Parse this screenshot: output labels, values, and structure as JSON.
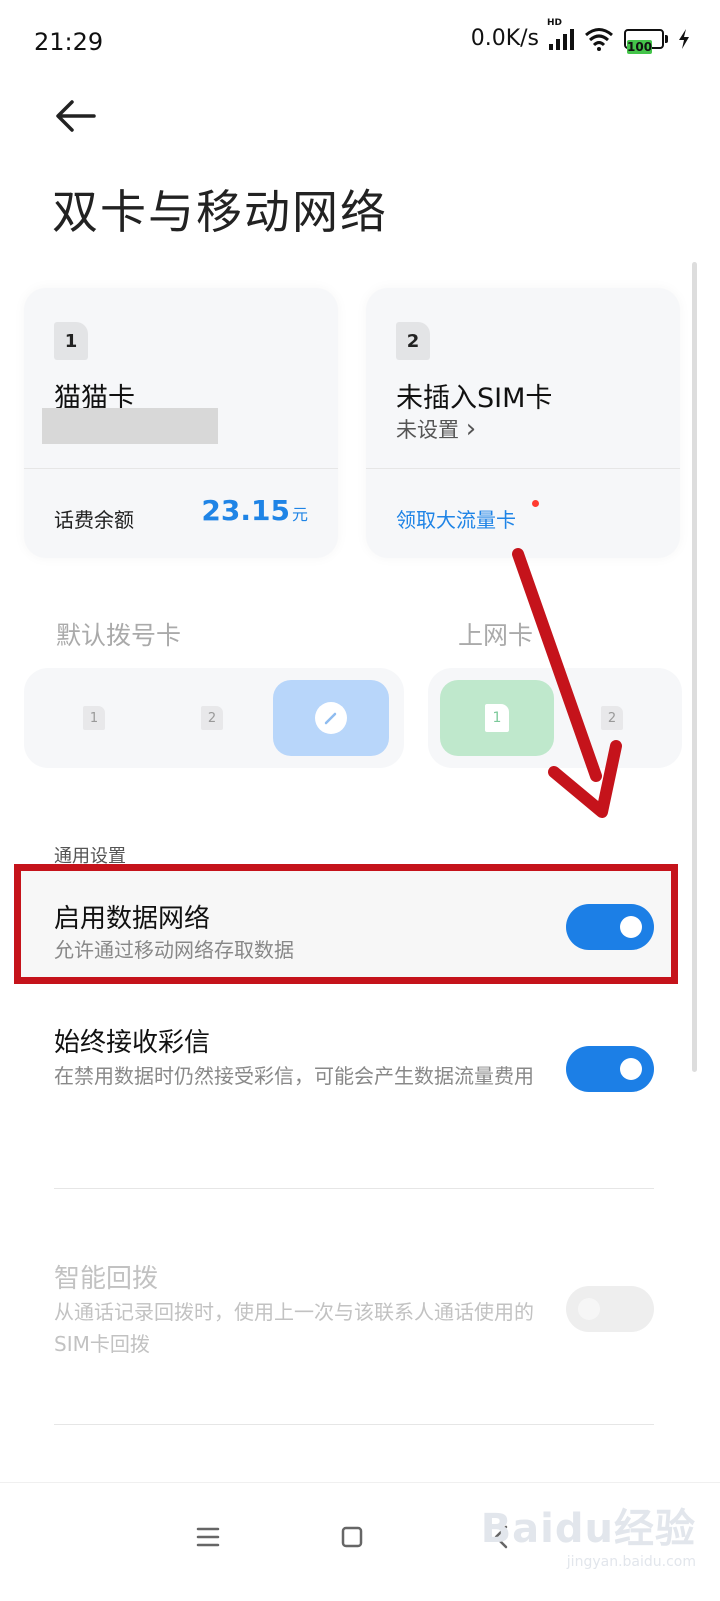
{
  "status_bar": {
    "time": "21:29",
    "speed": "0.0K/s",
    "signal_label": "HD",
    "battery": "100"
  },
  "page": {
    "title": "双卡与移动网络"
  },
  "sim_cards": [
    {
      "slot": "1",
      "name": "猫猫卡",
      "footer_label": "话费余额",
      "balance": "23.15",
      "balance_unit": "元"
    },
    {
      "slot": "2",
      "name": "未插入SIM卡",
      "status": "未设置 ",
      "status_chevron": "›",
      "footer_link": "领取大流量卡"
    }
  ],
  "defaults": {
    "dial_label": "默认拨号卡",
    "data_label": "上网卡",
    "dial_options": [
      "1",
      "2"
    ],
    "data_options": [
      "1",
      "2"
    ]
  },
  "general": {
    "section_label": "通用设置",
    "settings": [
      {
        "title": "启用数据网络",
        "desc": "允许通过移动网络存取数据",
        "enabled": true
      },
      {
        "title": "始终接收彩信",
        "desc": "在禁用数据时仍然接受彩信，可能会产生数据流量费用",
        "enabled": true
      },
      {
        "title": "智能回拨",
        "desc": "从通话记录回拨时，使用上一次与该联系人通话使用的SIM卡回拨",
        "enabled": false
      }
    ]
  },
  "watermark": {
    "main": "Baidu经验",
    "sub": "jingyan.baidu.com"
  },
  "colors": {
    "accent": "#1c7fe6",
    "highlight": "#c5131b",
    "data_card": "#bfe8cc",
    "dial_card": "#b8d6fa"
  }
}
